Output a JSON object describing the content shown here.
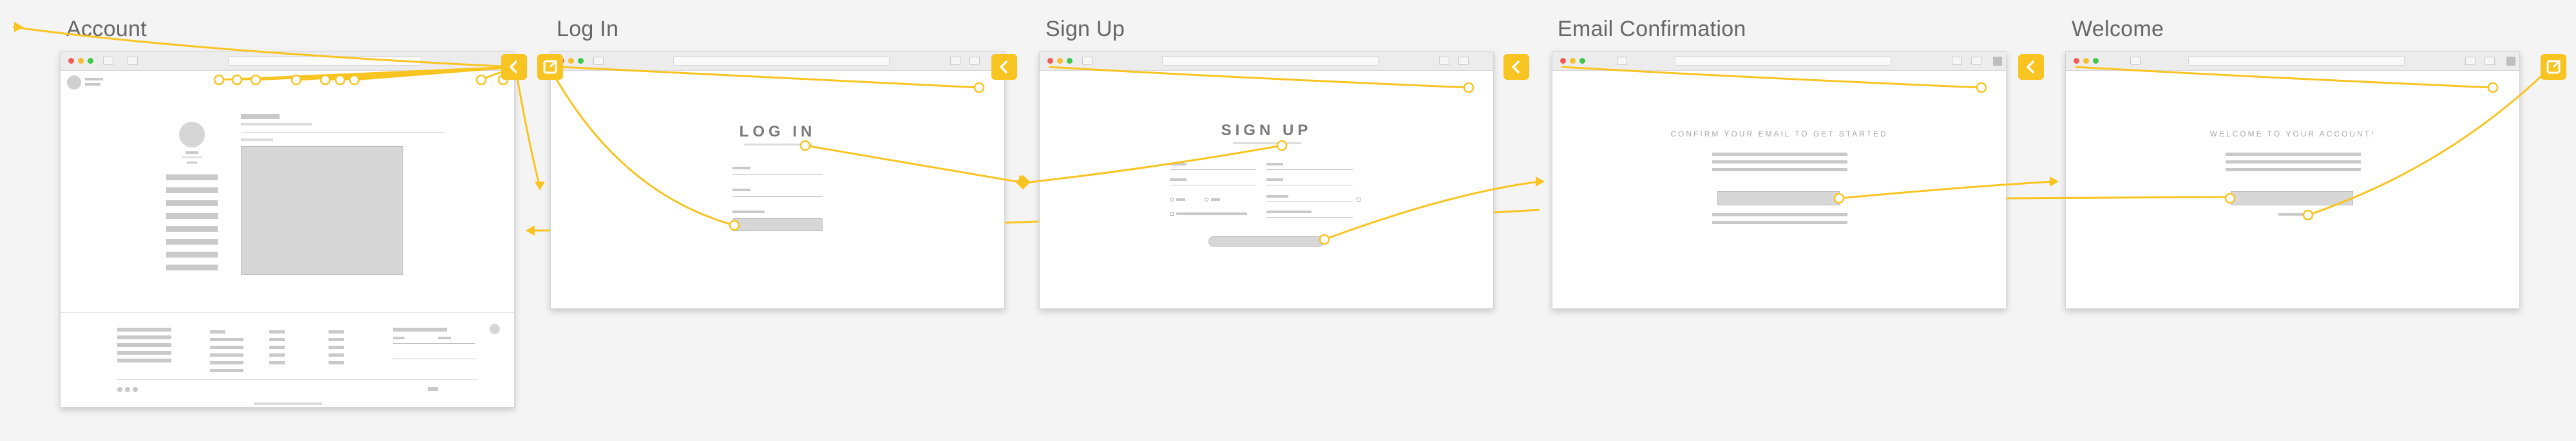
{
  "screens": [
    {
      "id": "account",
      "title": "Account"
    },
    {
      "id": "login",
      "title": "Log In"
    },
    {
      "id": "signup",
      "title": "Sign Up"
    },
    {
      "id": "email",
      "title": "Email Confirmation"
    },
    {
      "id": "welcome",
      "title": "Welcome"
    }
  ],
  "login": {
    "heading": "LOG IN"
  },
  "signup": {
    "heading": "SIGN UP"
  },
  "email": {
    "heading": "CONFIRM YOUR EMAIL TO GET STARTED"
  },
  "welcome": {
    "heading": "WELCOME TO YOUR ACCOUNT!"
  },
  "colors": {
    "link": "#f8c421",
    "badge": "#f8c421",
    "placeholder": "#d7d7d7"
  },
  "icons": {
    "back": "chevron-left-icon",
    "external": "external-link-icon",
    "home": "home-icon"
  }
}
